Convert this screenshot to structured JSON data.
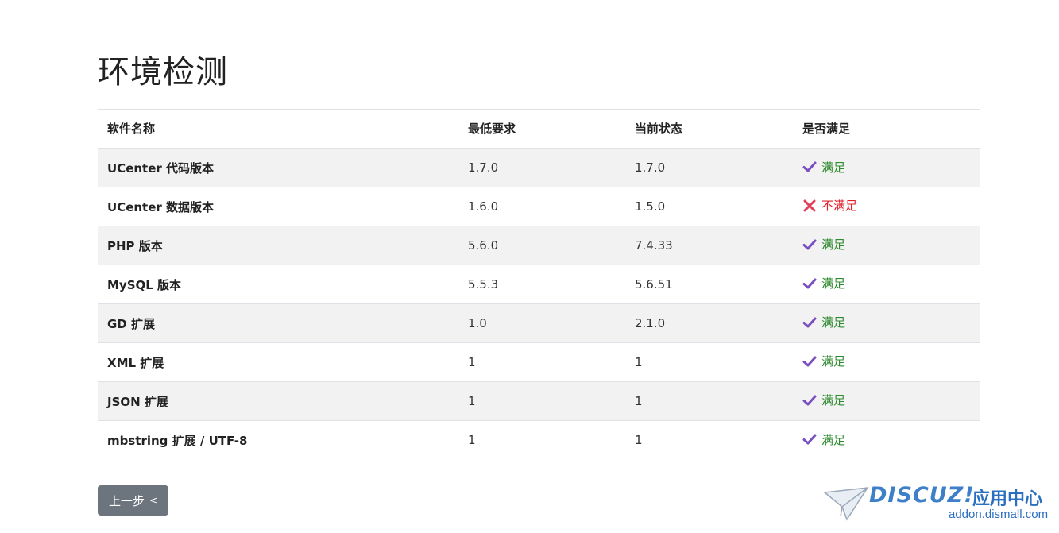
{
  "page": {
    "title": "环境检测"
  },
  "table": {
    "headers": [
      "软件名称",
      "最低要求",
      "当前状态",
      "是否满足"
    ],
    "rows": [
      {
        "name": "UCenter 代码版本",
        "required": "1.7.0",
        "current": "1.7.0",
        "status": "满足",
        "ok": true
      },
      {
        "name": "UCenter 数据版本",
        "required": "1.6.0",
        "current": "1.5.0",
        "status": "不满足",
        "ok": false
      },
      {
        "name": "PHP 版本",
        "required": "5.6.0",
        "current": "7.4.33",
        "status": "满足",
        "ok": true
      },
      {
        "name": "MySQL 版本",
        "required": "5.5.3",
        "current": "5.6.51",
        "status": "满足",
        "ok": true
      },
      {
        "name": "GD 扩展",
        "required": "1.0",
        "current": "2.1.0",
        "status": "满足",
        "ok": true
      },
      {
        "name": "XML 扩展",
        "required": "1",
        "current": "1",
        "status": "满足",
        "ok": true
      },
      {
        "name": "JSON 扩展",
        "required": "1",
        "current": "1",
        "status": "满足",
        "ok": true
      },
      {
        "name": "mbstring 扩展 / UTF-8",
        "required": "1",
        "current": "1",
        "status": "满足",
        "ok": true
      }
    ]
  },
  "actions": {
    "back_label": "上一步",
    "back_icon": "<"
  },
  "watermark": {
    "logo": "DISCUZ!",
    "cn": "应用中心",
    "url": "addon.dismall.com"
  },
  "colors": {
    "ok": "#2e8b2e",
    "fail": "#e0202a",
    "check_icon": "#7a4fc0",
    "button": "#6c757d"
  }
}
